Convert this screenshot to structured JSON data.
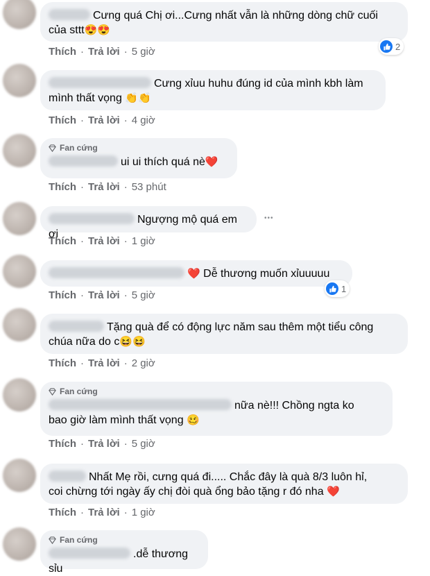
{
  "actions": {
    "like": "Thích",
    "reply": "Trả lời",
    "dot": "·"
  },
  "badge_label": "Fan cứng",
  "comments": [
    {
      "line1": "Cưng quá Chị ơi...Cưng nhất vẫn là những dòng chữ cuối",
      "line2": "của sttt",
      "emoji": "😍😍",
      "time": "5 giờ",
      "reactions": "2"
    },
    {
      "line1": "Cưng xỉuu huhu đúng id của mình kbh làm",
      "line2": "mình thất vọng",
      "emoji": "👏👏",
      "time": "4 giờ"
    },
    {
      "line1": "ui ui thích quá nè",
      "emoji": "❤️",
      "time": "53 phút"
    },
    {
      "line1": "Ngượng mộ quá em ơi",
      "time": "1 giờ",
      "more": "•••"
    },
    {
      "line1": "Dễ thương muốn xỉuuuuu",
      "emoji": "❤️",
      "time": "5 giờ",
      "reactions": "1"
    },
    {
      "line1": "Tặng quà để có động lực năm sau thêm một tiểu công",
      "line2": "chúa nữa do c",
      "emoji": "😆😆",
      "time": "2 giờ"
    },
    {
      "line1": "nữa nè!!! Chồng ngta ko",
      "line2": "bao giờ làm mình thất vọng",
      "emoji": "🥴",
      "time": "5 giờ"
    },
    {
      "line1": "Nhất Mẹ rồi, cưng quá đi..... Chắc đây là quà 8/3 luôn hỉ,",
      "line2": "coi chừng tới ngày ấy chị đòi quà ổng bảo tặng r đó nha",
      "emoji": "❤️",
      "time": "1 giờ"
    },
    {
      "line1": ".dễ thương sỉu"
    }
  ],
  "colors": {
    "bubble": "#f0f2f5",
    "action_text": "#65676b",
    "like_blue": "#1877f2",
    "heart": "#e41e3f"
  }
}
